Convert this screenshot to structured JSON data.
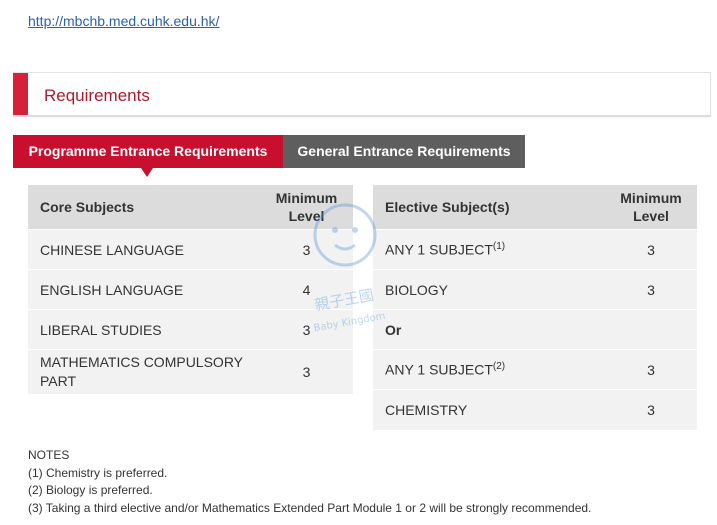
{
  "link": {
    "text": "http://mbchb.med.cuhk.edu.hk/"
  },
  "section": {
    "title": "Requirements"
  },
  "tabs": [
    {
      "label": "Programme Entrance Requirements",
      "active": true
    },
    {
      "label": "General Entrance Requirements",
      "active": false
    }
  ],
  "core_table": {
    "headers": {
      "subject": "Core Subjects",
      "level_line1": "Minimum",
      "level_line2": "Level"
    },
    "rows": [
      {
        "subject": "CHINESE LANGUAGE",
        "level": "3"
      },
      {
        "subject": "ENGLISH LANGUAGE",
        "level": "4"
      },
      {
        "subject": "LIBERAL STUDIES",
        "level": "3"
      },
      {
        "subject_line1": "MATHEMATICS COMPULSORY",
        "subject_line2": "PART",
        "level": "3"
      }
    ]
  },
  "elective_table": {
    "headers": {
      "subject": "Elective Subject(s)",
      "level_line1": "Minimum",
      "level_line2": "Level"
    },
    "rows": [
      {
        "subject": "ANY 1 SUBJECT",
        "sup": "(1)",
        "level": "3"
      },
      {
        "subject": "BIOLOGY",
        "level": "3"
      },
      {
        "subject": "Or",
        "level": ""
      },
      {
        "subject": "ANY 1 SUBJECT",
        "sup": "(2)",
        "level": "3"
      },
      {
        "subject": "CHEMISTRY",
        "level": "3"
      }
    ]
  },
  "notes": {
    "title": "NOTES",
    "items": [
      "(1) Chemistry is preferred.",
      "(2) Biology is preferred.",
      "(3) Taking a third elective and/or Mathematics Extended Part Module 1 or 2 will be strongly recommended."
    ]
  },
  "watermark": {
    "line1": "親子王國",
    "line2": "Baby Kingdom"
  },
  "colors": {
    "accent": "#c8102e",
    "inactive_tab": "#5e5e5e",
    "link": "#2b5fb3"
  }
}
